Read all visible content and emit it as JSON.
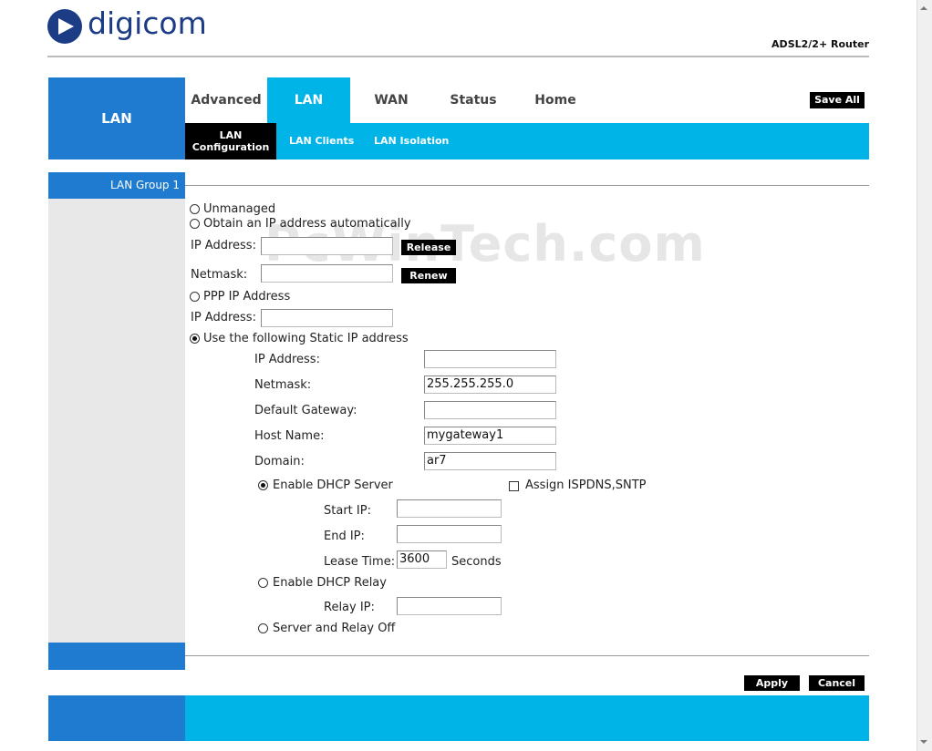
{
  "brand": {
    "logo_text": "digicom",
    "model": "ADSL2/2+ Router"
  },
  "nav": {
    "section_title": "LAN",
    "tabs": [
      {
        "label": "Advanced",
        "active": false
      },
      {
        "label": "LAN",
        "active": true
      },
      {
        "label": "WAN",
        "active": false
      },
      {
        "label": "Status",
        "active": false
      },
      {
        "label": "Home",
        "active": false
      }
    ],
    "save_all": "Save All",
    "subtabs": [
      "LAN Configuration",
      "LAN Clients",
      "LAN Isolation"
    ]
  },
  "group_title": "LAN Group 1",
  "watermark": "PcWinTech.com",
  "form": {
    "unmanaged": "Unmanaged",
    "obtain_auto": "Obtain an IP address automatically",
    "auto_ip_label": "IP Address:",
    "auto_netmask_label": "Netmask:",
    "release": "Release",
    "renew": "Renew",
    "ppp_ip": "PPP IP Address",
    "ppp_ip_label": "IP Address:",
    "static": "Use the following Static IP address",
    "static_fields": {
      "ip_label": "IP Address:",
      "ip_value": "",
      "netmask_label": "Netmask:",
      "netmask_value": "255.255.255.0",
      "gateway_label": "Default Gateway:",
      "gateway_value": "",
      "host_label": "Host Name:",
      "host_value": "mygateway1",
      "domain_label": "Domain:",
      "domain_value": "ar7"
    },
    "enable_dhcp_server": "Enable DHCP Server",
    "assign_ispdns": "Assign ISPDNS,SNTP",
    "start_ip_label": "Start IP:",
    "end_ip_label": "End IP:",
    "lease_label": "Lease Time:",
    "lease_value": "3600",
    "lease_unit": "Seconds",
    "enable_dhcp_relay": "Enable DHCP Relay",
    "relay_ip_label": "Relay IP:",
    "server_relay_off": "Server and Relay Off",
    "selected_mode": "static",
    "selected_dhcp": "server"
  },
  "actions": {
    "apply": "Apply",
    "cancel": "Cancel"
  }
}
